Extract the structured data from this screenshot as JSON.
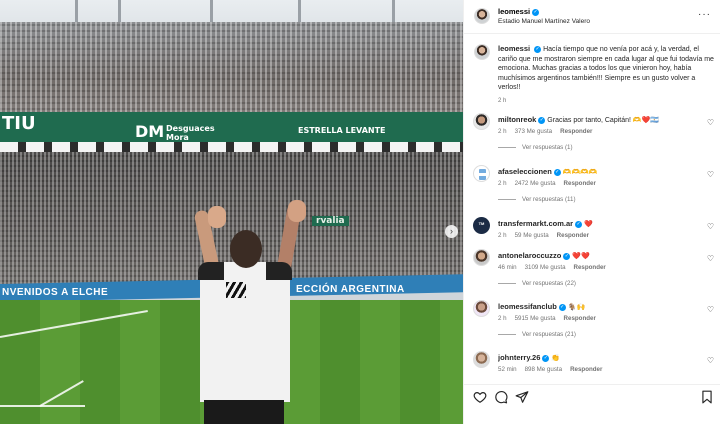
{
  "post": {
    "author": "leomessi",
    "location": "Estadio Manuel Martínez Valero",
    "caption": "Hacía tiempo que no venía por acá y, la verdad, el cariño que me mostraron siempre en cada lugar al que fui todavía me emociona. Muchas gracias a todos los que vinieron hoy, había muchísimos argentinos también!!! Siempre es un gusto volver a verlos!!",
    "caption_time": "2 h"
  },
  "photo": {
    "banner_left": "TIU",
    "banner_dm": "DM",
    "banner_sponsor": "Desguaces",
    "banner_sponsor2": "Mora",
    "banner_right": "ESTRELLA LEVANTE",
    "board_left": "NVENIDOS A ELCHE",
    "board_right": "ECCIÓN ARGENTINA",
    "stadium_sign": "rvalia"
  },
  "comments": [
    {
      "user": "miltonreok",
      "verified": true,
      "text": "Gracias por tanto, Capitán! 🫶❤️🇦🇷",
      "time": "2 h",
      "likes": "373 Me gusta",
      "reply": "Responder",
      "views": "Ver respuestas (1)"
    },
    {
      "user": "afaseleccionen",
      "verified": true,
      "text": "🫶🫶🫶🫶",
      "time": "2 h",
      "likes": "2472 Me gusta",
      "reply": "Responder",
      "views": "Ver respuestas (11)"
    },
    {
      "user": "transfermarkt.com.ar",
      "verified": true,
      "text": "❤️",
      "time": "2 h",
      "likes": "59 Me gusta",
      "reply": "Responder",
      "views": ""
    },
    {
      "user": "antonelaroccuzzo",
      "verified": true,
      "text": "❤️❤️",
      "time": "46 min",
      "likes": "3109 Me gusta",
      "reply": "Responder",
      "views": "Ver respuestas (22)"
    },
    {
      "user": "leomessifanclub",
      "verified": true,
      "text": "🐐🙌",
      "time": "2 h",
      "likes": "5915 Me gusta",
      "reply": "Responder",
      "views": "Ver respuestas (21)"
    },
    {
      "user": "johnterry.26",
      "verified": true,
      "text": "👏",
      "time": "52 min",
      "likes": "898 Me gusta",
      "reply": "Responder",
      "views": ""
    }
  ],
  "icons": {
    "more": "more-icon",
    "heart": "heart-icon",
    "comment": "comment-icon",
    "share": "share-icon",
    "bookmark": "bookmark-icon",
    "verified": "verified-badge-icon",
    "next": "chevron-right-icon"
  },
  "colors": {
    "verified": "#0095f6",
    "muted": "#737373",
    "pitch": "#4f8f2e",
    "banner": "#1f6b4f"
  }
}
